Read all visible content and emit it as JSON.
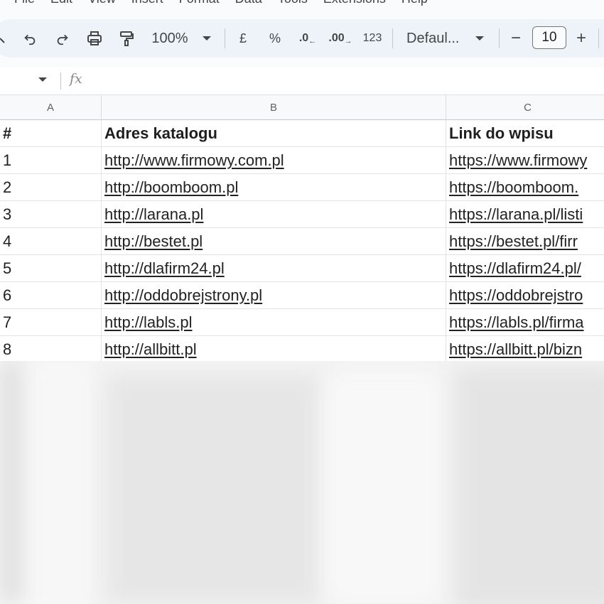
{
  "menu": [
    "File",
    "Edit",
    "View",
    "Insert",
    "Format",
    "Data",
    "Tools",
    "Extensions",
    "Help"
  ],
  "toolbar": {
    "zoom": "100%",
    "currency": "£",
    "percent": "%",
    "decrease_decimal": ".0",
    "increase_decimal": ".00",
    "number_format": "123",
    "font": "Defaul...",
    "font_size": "10",
    "minus": "−",
    "plus": "+"
  },
  "formula_bar": {
    "fx": "fx"
  },
  "columns": [
    "A",
    "B",
    "C"
  ],
  "header_row": [
    "#",
    "Adres katalogu",
    "Link do wpisu"
  ],
  "rows": [
    [
      "1",
      "http://www.firmowy.com.pl",
      "https://www.firmowy"
    ],
    [
      "2",
      "http://boomboom.pl",
      "https://boomboom."
    ],
    [
      "3",
      "http://larana.pl",
      "https://larana.pl/listi"
    ],
    [
      "4",
      "http://bestet.pl",
      "https://bestet.pl/firr"
    ],
    [
      "5",
      "http://dlafirm24.pl",
      "https://dlafirm24.pl/"
    ],
    [
      "6",
      "http://oddobrejstrony.pl",
      "https://oddobrejstro"
    ],
    [
      "7",
      "http://labls.pl",
      "https://labls.pl/firma"
    ],
    [
      "8",
      "http://allbitt.pl",
      "https://allbitt.pl/bizn"
    ]
  ]
}
